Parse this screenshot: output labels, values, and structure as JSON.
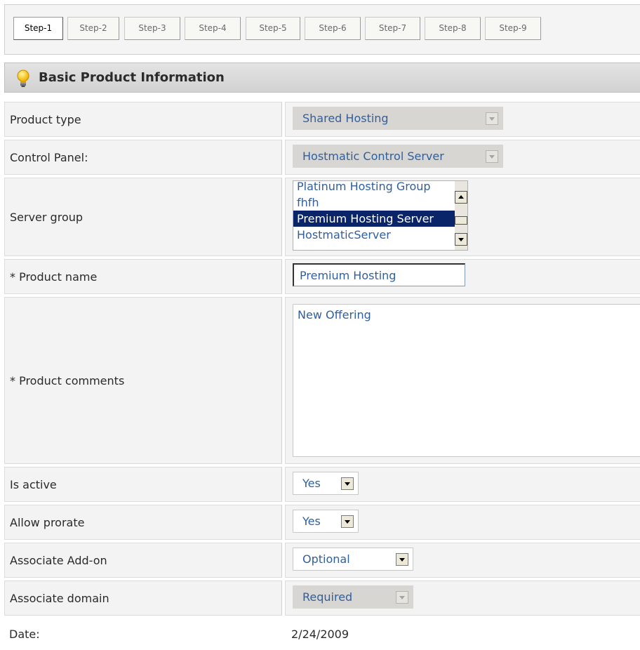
{
  "steps": [
    "Step-1",
    "Step-2",
    "Step-3",
    "Step-4",
    "Step-5",
    "Step-6",
    "Step-7",
    "Step-8",
    "Step-9"
  ],
  "active_step": "Step-1",
  "section": {
    "title": "Basic Product Information",
    "icon": "lightbulb-icon"
  },
  "form": {
    "product_type": {
      "label": "Product type",
      "value": "Shared Hosting"
    },
    "control_panel": {
      "label": "Control Panel:",
      "value": "Hostmatic Control Server"
    },
    "server_group": {
      "label": "Server group",
      "options": [
        "Platinum Hosting Group",
        "fhfh",
        "Premium Hosting Server",
        "HostmaticServer"
      ],
      "selected": "Premium Hosting Server"
    },
    "product_name": {
      "label": "* Product name",
      "value": "Premium Hosting"
    },
    "product_comments": {
      "label": "* Product comments",
      "value": "New Offering"
    },
    "is_active": {
      "label": "Is active",
      "value": "Yes"
    },
    "allow_prorate": {
      "label": "Allow prorate",
      "value": "Yes"
    },
    "associate_addon": {
      "label": "Associate Add-on",
      "value": "Optional"
    },
    "associate_domain": {
      "label": "Associate domain",
      "value": "Required"
    },
    "date": {
      "label": "Date:",
      "value": "2/24/2009"
    }
  },
  "colors": {
    "value_text": "#2f5f9e",
    "selected_bg": "#0a246a",
    "header_bg": "#d8d8d8"
  }
}
